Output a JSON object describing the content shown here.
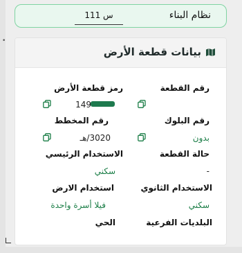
{
  "building_system": {
    "label": "نظام البناء",
    "value": "س 111"
  },
  "panel": {
    "title": "بيانات قطعة الأرض",
    "fields": {
      "land_code": {
        "label": "رمز قطعة الأرض",
        "value": "149"
      },
      "plot_number": {
        "label": "رقم القطعة",
        "value": ""
      },
      "plan_number": {
        "label": "رقم المخطط",
        "value": "3020/هـ"
      },
      "block_number": {
        "label": "رقم البلوك",
        "value": "بدون"
      },
      "main_use": {
        "label": "الاستخدام الرئيسي",
        "value": "سكني"
      },
      "plot_status": {
        "label": "حالة القطعة",
        "value": "-"
      },
      "land_use": {
        "label": "استخدام الارض",
        "value": "فيلا أسرة واحدة"
      },
      "secondary_use": {
        "label": "الاستخدام الثانوي",
        "value": "سكني"
      },
      "district": {
        "label": "الحي",
        "value": ""
      },
      "sub_municipalities": {
        "label": "البلديات الفرعية",
        "value": ""
      }
    }
  },
  "colors": {
    "accent": "#1a7d46",
    "header_bg": "#f4f4f4",
    "banner_bg": "#e9f7ef",
    "banner_border": "#7fd3a2"
  },
  "icons": {
    "header": "map-icon",
    "copy": "copy-icon"
  }
}
